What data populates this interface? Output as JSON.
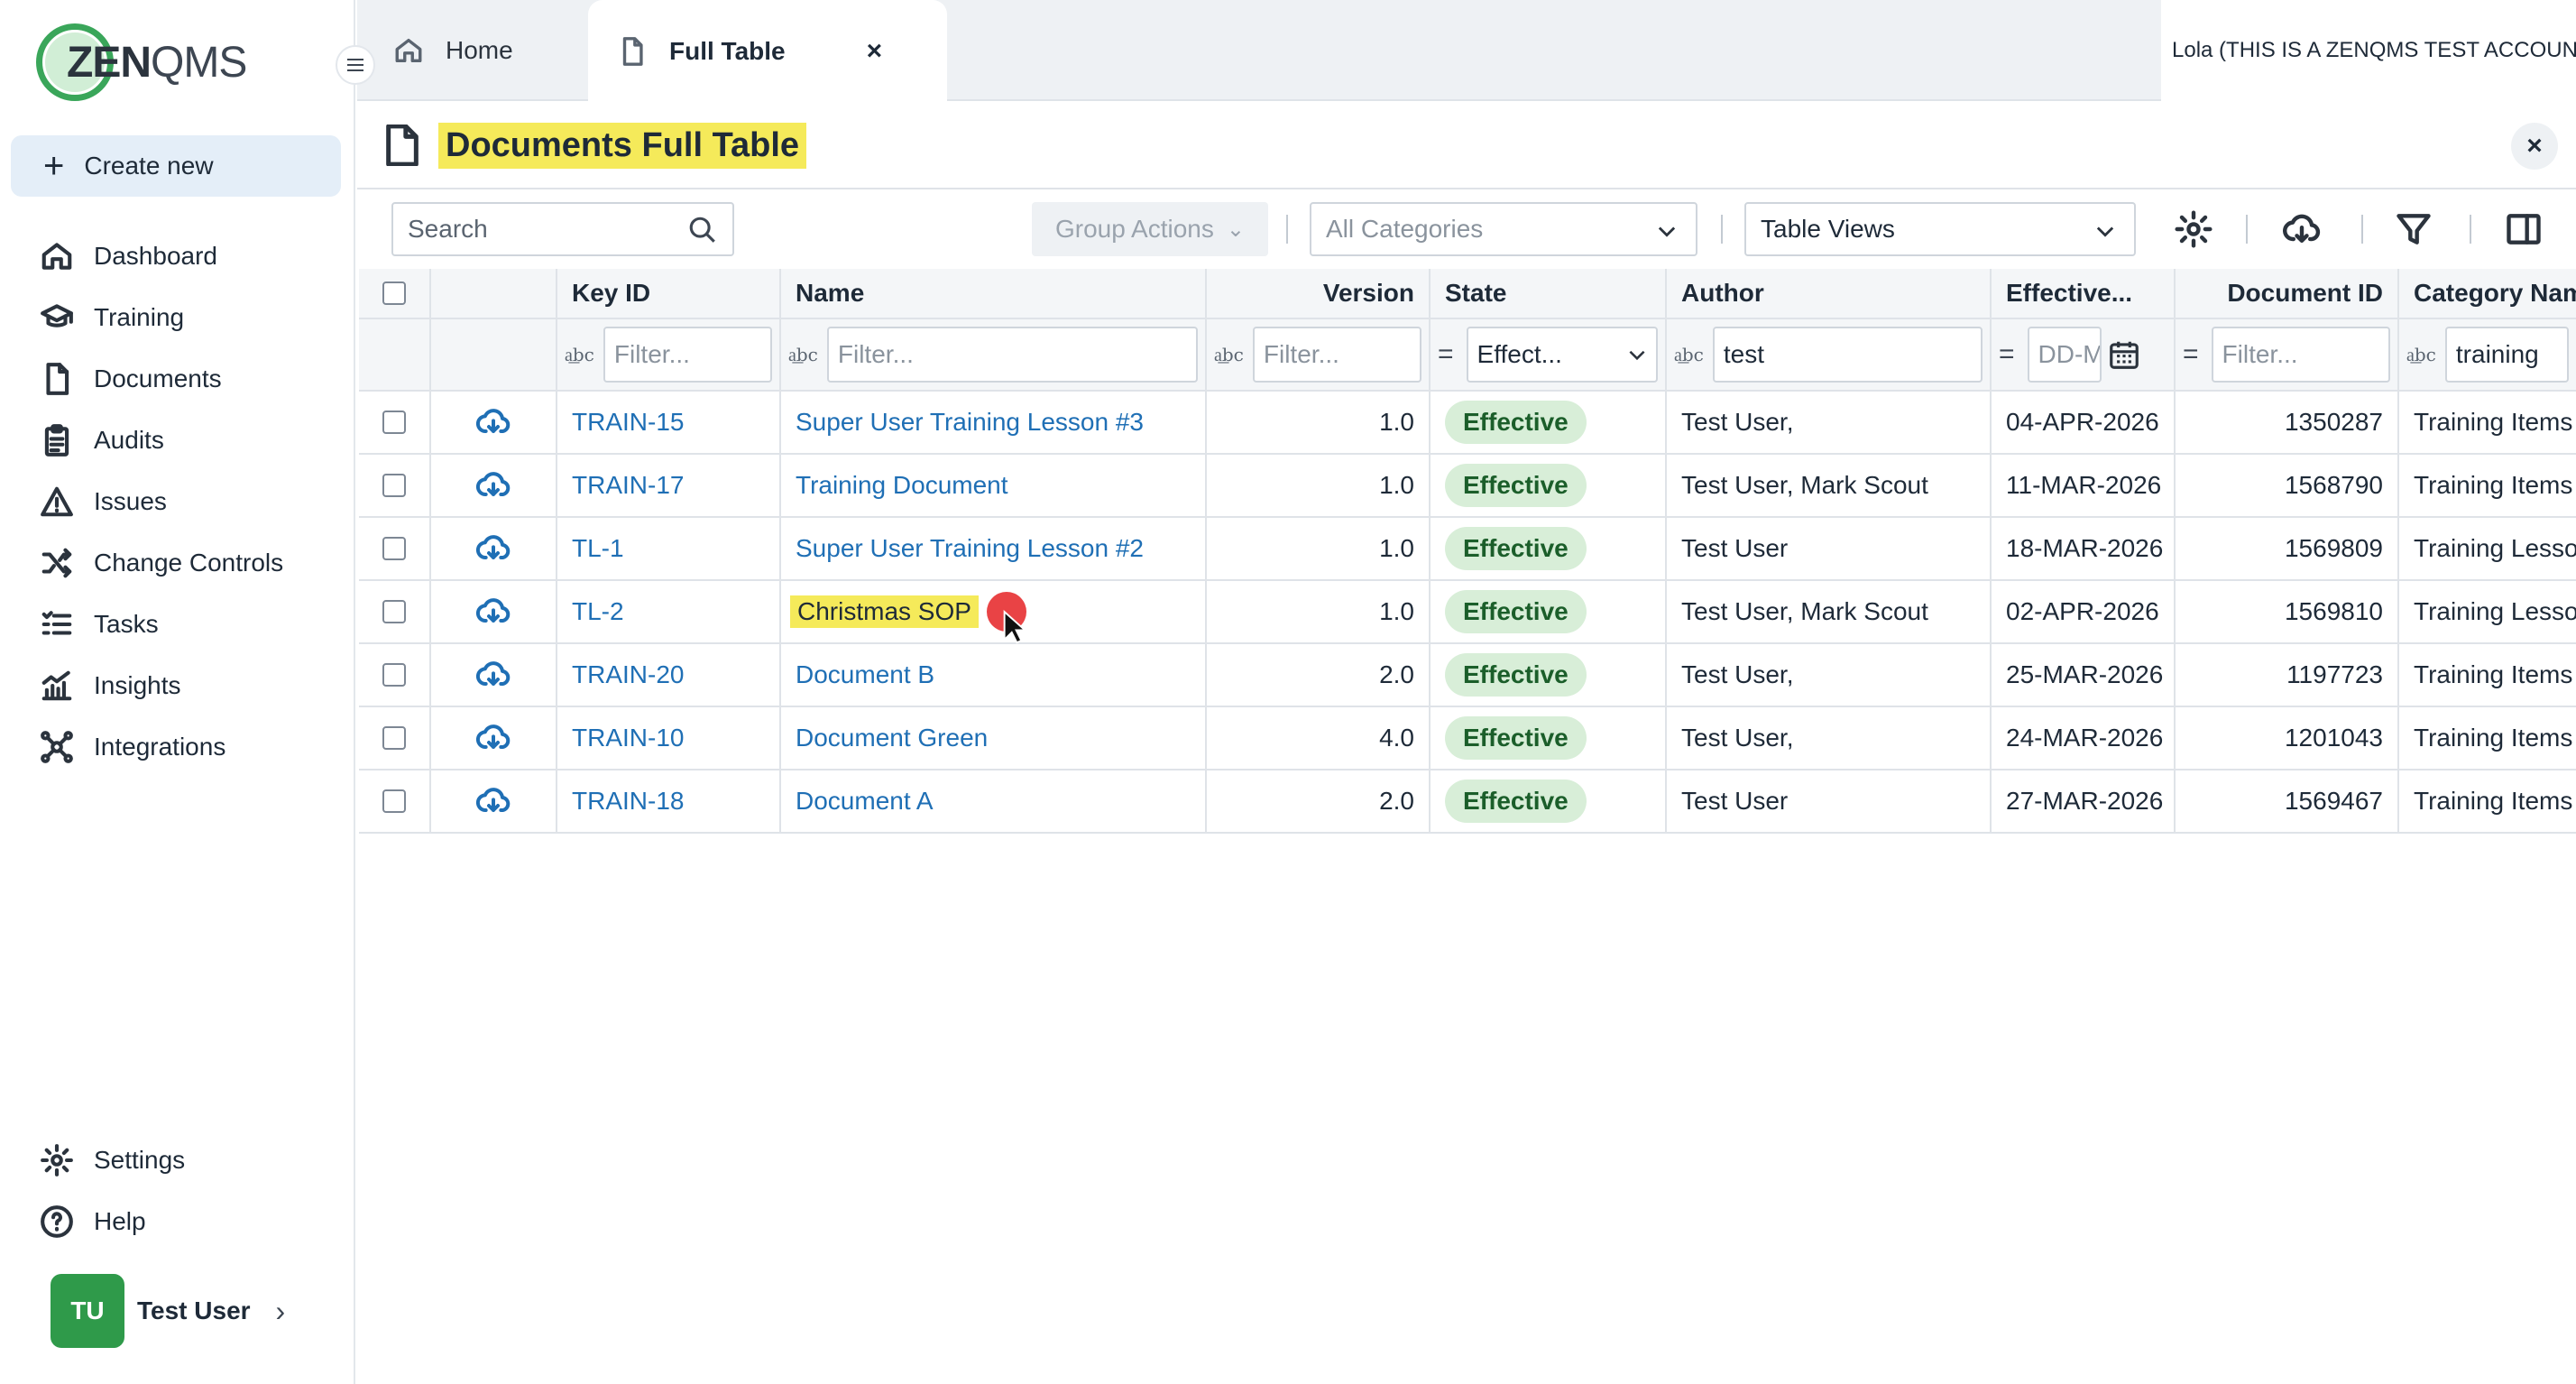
{
  "logo": {
    "bold": "ZEN",
    "light": "QMS"
  },
  "sidebar": {
    "create_label": "Create new",
    "items": [
      {
        "label": "Dashboard",
        "icon": "home-icon"
      },
      {
        "label": "Training",
        "icon": "graduation-cap-icon"
      },
      {
        "label": "Documents",
        "icon": "document-icon"
      },
      {
        "label": "Audits",
        "icon": "clipboard-icon"
      },
      {
        "label": "Issues",
        "icon": "warning-icon"
      },
      {
        "label": "Change Controls",
        "icon": "shuffle-icon"
      },
      {
        "label": "Tasks",
        "icon": "checklist-icon"
      },
      {
        "label": "Insights",
        "icon": "chart-icon"
      },
      {
        "label": "Integrations",
        "icon": "network-icon"
      }
    ],
    "bottom_items": [
      {
        "label": "Settings",
        "icon": "gear-icon"
      },
      {
        "label": "Help",
        "icon": "help-icon"
      }
    ],
    "user": {
      "initials": "TU",
      "name": "Test User"
    }
  },
  "tabs": {
    "home_label": "Home",
    "active_label": "Full Table",
    "close_glyph": "×"
  },
  "account_label": "Lola (THIS IS A ZENQMS TEST ACCOUNT)",
  "page": {
    "title": "Documents Full Table",
    "close_glyph": "×"
  },
  "toolbar": {
    "search_placeholder": "Search",
    "group_actions_label": "Group Actions",
    "category_label": "All Categories",
    "views_label": "Table Views"
  },
  "table": {
    "columns": [
      "Key ID",
      "Name",
      "Version",
      "State",
      "Author",
      "Effective...",
      "Document ID",
      "Category Name"
    ],
    "filters": {
      "key_id": "Filter...",
      "name": "Filter...",
      "version": "Filter...",
      "state": "Effect...",
      "author": "test",
      "effective": "DD-M",
      "document_id": "Filter...",
      "category": "training"
    },
    "rows": [
      {
        "key": "TRAIN-15",
        "name": "Super User Training Lesson #3",
        "version": "1.0",
        "state": "Effective",
        "author": "Test User,",
        "date": "04-APR-2026",
        "doc_id": "1350287",
        "category": "Training Items"
      },
      {
        "key": "TRAIN-17",
        "name": "Training Document",
        "version": "1.0",
        "state": "Effective",
        "author": "Test User, Mark Scout",
        "date": "11-MAR-2026",
        "doc_id": "1568790",
        "category": "Training Items"
      },
      {
        "key": "TL-1",
        "name": "Super User Training Lesson #2",
        "version": "1.0",
        "state": "Effective",
        "author": "Test User",
        "date": "18-MAR-2026",
        "doc_id": "1569809",
        "category": "Training Lessons"
      },
      {
        "key": "TL-2",
        "name": "Christmas SOP",
        "version": "1.0",
        "state": "Effective",
        "author": "Test User, Mark Scout",
        "date": "02-APR-2026",
        "doc_id": "1569810",
        "category": "Training Lessons"
      },
      {
        "key": "TRAIN-20",
        "name": "Document B",
        "version": "2.0",
        "state": "Effective",
        "author": "Test User,",
        "date": "25-MAR-2026",
        "doc_id": "1197723",
        "category": "Training Items"
      },
      {
        "key": "TRAIN-10",
        "name": "Document Green",
        "version": "4.0",
        "state": "Effective",
        "author": "Test User,",
        "date": "24-MAR-2026",
        "doc_id": "1201043",
        "category": "Training Items"
      },
      {
        "key": "TRAIN-18",
        "name": "Document A",
        "version": "2.0",
        "state": "Effective",
        "author": "Test User",
        "date": "27-MAR-2026",
        "doc_id": "1569467",
        "category": "Training Items"
      }
    ]
  },
  "colors": {
    "accent": "#1f6fb5",
    "brand_green": "#3aa65a",
    "highlight": "#f5ea5a",
    "badge_bg": "#d8eed8",
    "cursor": "#e8393b"
  }
}
